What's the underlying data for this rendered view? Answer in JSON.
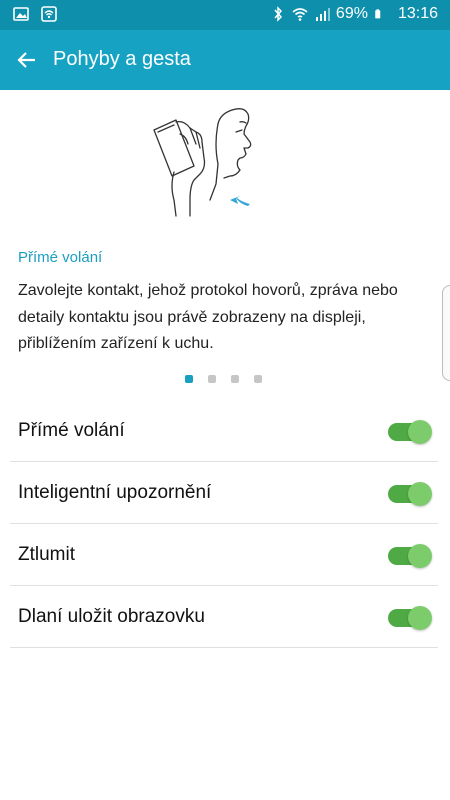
{
  "status_bar": {
    "battery_percent": "69%",
    "time": "13:16",
    "icons": [
      "image-icon",
      "wifi-notification-icon",
      "bluetooth-icon",
      "wifi-icon",
      "signal-icon",
      "battery-icon"
    ]
  },
  "app_bar": {
    "title": "Pohyby a gesta",
    "back_icon": "arrow-left-icon",
    "color": "#16a3c3"
  },
  "tip": {
    "title": "Přímé volání",
    "description": "Zavolejte kontakt, jehož protokol hovorů, zpráva nebo detaily kontaktu jsou právě zobrazeny na displeji, přiblížením zařízení k uchu.",
    "illustration": "phone-to-ear-illustration",
    "page_indicator": {
      "count": 4,
      "active": 1
    }
  },
  "settings": {
    "items": [
      {
        "label": "Přímé volání",
        "enabled": true
      },
      {
        "label": "Inteligentní upozornění",
        "enabled": true
      },
      {
        "label": "Ztlumit",
        "enabled": true
      },
      {
        "label": "Dlaní uložit obrazovku",
        "enabled": true
      }
    ],
    "toggle_on_color": "#4faa46"
  }
}
